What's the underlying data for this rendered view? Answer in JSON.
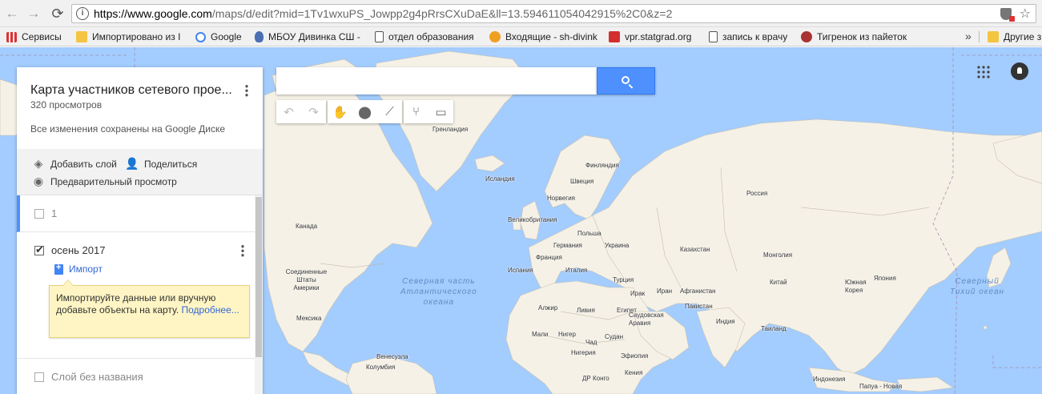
{
  "browser": {
    "url_host": "https://www.google.com",
    "url_path": "/maps/d/edit?mid=1Tv1wxuPS_Jowpp2g4pRrsCXuDaE&ll=13.594611054042915%2C0&z=2",
    "bookmarks": [
      {
        "label": "Сервисы",
        "icon": "apps-icon"
      },
      {
        "label": "Импортировано из I",
        "icon": "folder-icon"
      },
      {
        "label": "Google",
        "icon": "google-icon"
      },
      {
        "label": "МБОУ Дивинка СШ -",
        "icon": "shield-icon"
      },
      {
        "label": "отдел образования",
        "icon": "doc-icon"
      },
      {
        "label": "Входящие - sh-divink",
        "icon": "mail-icon"
      },
      {
        "label": "vpr.statgrad.org",
        "icon": "statgrad-icon"
      },
      {
        "label": "запись к врачу",
        "icon": "doc-icon"
      },
      {
        "label": "Тигренок из пайеток",
        "icon": "tiger-icon"
      },
      {
        "label": "Другие з",
        "icon": "folder-icon"
      }
    ],
    "more_label": "»"
  },
  "panel": {
    "title": "Карта участников сетевого прое...",
    "views": "320 просмотров",
    "saved": "Все изменения сохранены на Google Диске",
    "add_layer": "Добавить слой",
    "share": "Поделиться",
    "preview": "Предварительный просмотр",
    "layers": [
      {
        "name": "1",
        "checked": false
      },
      {
        "name": "осень 2017",
        "checked": true
      },
      {
        "name": "Слой без названия",
        "checked": false
      }
    ],
    "import_label": "Импорт",
    "tip_text": "Импортируйте данные или вручную добавьте объекты на карту.",
    "tip_link": "Подробнее..."
  },
  "search": {
    "placeholder": "",
    "value": ""
  },
  "tools": [
    "undo-icon",
    "redo-icon",
    "hand-icon",
    "marker-icon",
    "line-icon",
    "directions-icon",
    "ruler-icon"
  ],
  "map": {
    "labels": [
      {
        "id": "greenland",
        "text": "Гренландия"
      },
      {
        "id": "finland",
        "text": "Финляндия"
      },
      {
        "id": "iceland",
        "text": "Исландия"
      },
      {
        "id": "sweden",
        "text": "Швеция"
      },
      {
        "id": "norway",
        "text": "Норвегия"
      },
      {
        "id": "russia",
        "text": "Россия"
      },
      {
        "id": "uk",
        "text": "Великобритания"
      },
      {
        "id": "canada",
        "text": "Канада"
      },
      {
        "id": "poland",
        "text": "Польша"
      },
      {
        "id": "germany",
        "text": "Германия"
      },
      {
        "id": "ukraine",
        "text": "Украина"
      },
      {
        "id": "france",
        "text": "Франция"
      },
      {
        "id": "kazakhstan",
        "text": "Казахстан"
      },
      {
        "id": "mongolia",
        "text": "Монголия"
      },
      {
        "id": "spain",
        "text": "Испания"
      },
      {
        "id": "italy",
        "text": "Италия"
      },
      {
        "id": "usa",
        "text": "Соединенные Штаты Америки"
      },
      {
        "id": "turkey",
        "text": "Турция"
      },
      {
        "id": "china",
        "text": "Китай"
      },
      {
        "id": "skorea",
        "text": "Южная Корея"
      },
      {
        "id": "japan",
        "text": "Япония"
      },
      {
        "id": "iraq",
        "text": "Ирак"
      },
      {
        "id": "iran",
        "text": "Иран"
      },
      {
        "id": "afghanistan",
        "text": "Афганистан"
      },
      {
        "id": "mexico",
        "text": "Мексика"
      },
      {
        "id": "algeria",
        "text": "Алжир"
      },
      {
        "id": "libya",
        "text": "Ливия"
      },
      {
        "id": "egypt",
        "text": "Египет"
      },
      {
        "id": "pakistan",
        "text": "Пакистан"
      },
      {
        "id": "saudi",
        "text": "Саудовская Аравия"
      },
      {
        "id": "india",
        "text": "Индия"
      },
      {
        "id": "thailand",
        "text": "Таиланд"
      },
      {
        "id": "mali",
        "text": "Мали"
      },
      {
        "id": "niger",
        "text": "Нигер"
      },
      {
        "id": "chad",
        "text": "Чад"
      },
      {
        "id": "sudan",
        "text": "Судан"
      },
      {
        "id": "nigeria",
        "text": "Нигерия"
      },
      {
        "id": "ethiopia",
        "text": "Эфиопия"
      },
      {
        "id": "venezuela",
        "text": "Венесуэла"
      },
      {
        "id": "colombia",
        "text": "Колумбия"
      },
      {
        "id": "drc",
        "text": "ДР Конго"
      },
      {
        "id": "kenya",
        "text": "Кения"
      },
      {
        "id": "indonesia",
        "text": "Индонезия"
      },
      {
        "id": "png",
        "text": "Папуа - Новая"
      }
    ],
    "oceans": [
      {
        "id": "atlantic",
        "lines": [
          "Северная часть",
          "Атлантического",
          "океана"
        ]
      },
      {
        "id": "pacific",
        "lines": [
          "Северный",
          "Тихий океан"
        ]
      }
    ]
  }
}
